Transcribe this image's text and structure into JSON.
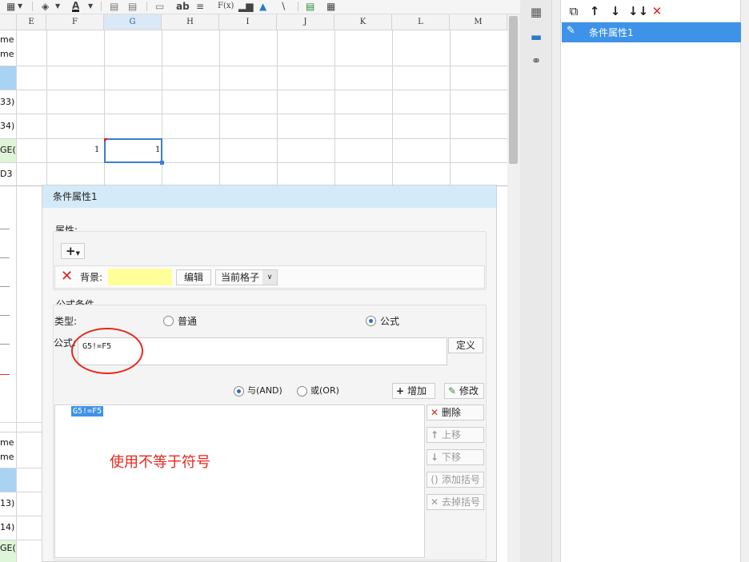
{
  "toolbar": {
    "icons": [
      "table-icon",
      "paint-bucket-icon",
      "font-color-icon",
      "merge-icon",
      "border-icon",
      "input-box-icon",
      "text-icon",
      "align-icon",
      "formula-icon",
      "chart-icon",
      "image-icon",
      "slash-icon",
      "list-icon",
      "grid-icon"
    ],
    "text_glyph": "ab",
    "formula_glyph": "F(x)",
    "font_color_glyph": "A"
  },
  "sheet": {
    "columns": [
      "E",
      "F",
      "G",
      "H",
      "I",
      "J",
      "K",
      "L",
      "M"
    ],
    "selected_column": "G",
    "upper_row_labels": [
      "me",
      "me",
      "33)",
      "34)",
      "GE(",
      "D3"
    ],
    "lower_row_labels": [
      "me",
      "me",
      "13)",
      "14)",
      "GE("
    ],
    "cell_F5": "1",
    "cell_G5": "1"
  },
  "icon_strip": [
    "cell-attribute-icon",
    "condition-attribute-icon",
    "hyperlink-icon"
  ],
  "right_panel": {
    "items": [
      "条件属性1"
    ],
    "toolbar_icons": [
      "copy-icon",
      "move-up-icon",
      "move-down-icon",
      "move-bottom-icon",
      "delete-icon"
    ]
  },
  "dialog": {
    "title": "条件属性1",
    "attributes_label": "属性:",
    "add_glyph": "+",
    "background_label": "背景:",
    "background_color": "#ffff99",
    "edit_button": "编辑",
    "scope_select": "当前格子",
    "formula_condition_label": "公式条件",
    "type_label": "类型:",
    "type_options": [
      "普通",
      "公式"
    ],
    "type_selected": "公式",
    "formula_label": "公式:",
    "formula_value": "G5!=F5",
    "define_button": "定义",
    "logic_options": [
      "与(AND)",
      "或(OR)"
    ],
    "logic_selected": "与(AND)",
    "add_button": "增加",
    "modify_button": "修改",
    "conditions": [
      "G5!=F5"
    ],
    "delete_button": "删除",
    "move_up_button": "上移",
    "move_down_button": "下移",
    "add_bracket_button": "添加括号",
    "remove_bracket_button": "去掉括号",
    "annotation": "使用不等于符号",
    "annotation_color": "#e8261c"
  }
}
